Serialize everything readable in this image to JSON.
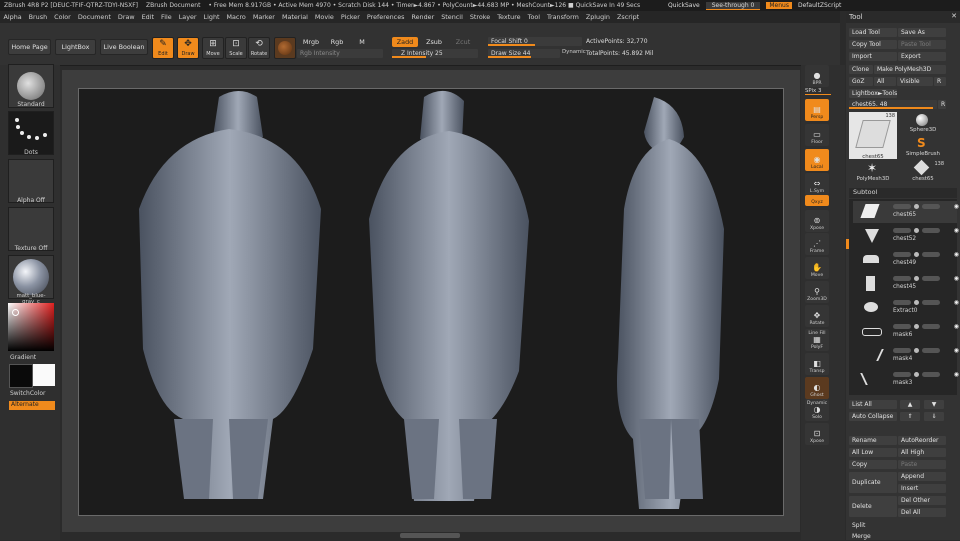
{
  "titlebar": {
    "app": "ZBrush 4R8 P2 [DEUC-TFIF-QTRZ-TDYI-NSXF]",
    "document": "ZBrush Document",
    "status": "• Free Mem 8.917GB • Active Mem 4970 • Scratch Disk 144 • Timer►4.867 • PolyCount►44.683 MP • MeshCount►126 ■ QuickSave In 49 Secs",
    "quicksave": "QuickSave",
    "seethrough": "See-through  0",
    "menus": "Menus",
    "script": "DefaultZScript"
  },
  "menu": [
    "Alpha",
    "Brush",
    "Color",
    "Document",
    "Draw",
    "Edit",
    "File",
    "Layer",
    "Light",
    "Macro",
    "Marker",
    "Material",
    "Movie",
    "Picker",
    "Preferences",
    "Render",
    "Stencil",
    "Stroke",
    "Texture",
    "Tool",
    "Transform",
    "Zplugin",
    "Zscript"
  ],
  "toolbar": {
    "home": "Home Page",
    "lightbox": "LightBox",
    "liveboolean": "Live Boolean",
    "edit": "Edit",
    "draw": "Draw",
    "move": "Move",
    "scale": "Scale",
    "rotate": "Rotate",
    "mrgb": "Mrgb",
    "rgb": "Rgb",
    "m": "M",
    "rgb_intensity": "Rgb Intensity",
    "zadd": "Zadd",
    "zsub": "Zsub",
    "zcut": "Zcut",
    "z_intensity": "Z Intensity 25",
    "focal": "Focal Shift 0",
    "drawsize": "Draw Size 44",
    "dynamic": "Dynamic",
    "active_points": "ActivePoints: 32,770",
    "total_points": "TotalPoints: 45.892 Mil"
  },
  "left": {
    "brush": "Standard",
    "stroke": "Dots",
    "alpha": "Alpha Off",
    "texture": "Texture Off",
    "material": "matt_blue-gray_c",
    "gradient": "Gradient",
    "switch": "SwitchColor",
    "alternate": "Alternate"
  },
  "right": {
    "bpr": "BPR",
    "spix": "SPix 3",
    "persp": "Persp",
    "floor": "Floor",
    "local": "Local",
    "lsym": "L.Sym",
    "xyz": "Qxyz",
    "frame": "Frame",
    "move": "Move",
    "zoom3d": "Zoom3D",
    "rotate": "Rotate",
    "linefill": "Line Fill",
    "polyf": "PolyF",
    "transp": "Transp",
    "ghost": "Ghost",
    "solo": "Solo",
    "xpose": "Xpose",
    "dynamic": "Dynamic"
  },
  "tool": {
    "title": "Tool",
    "load": "Load Tool",
    "saveas": "Save As",
    "copy": "Copy Tool",
    "paste": "Paste Tool",
    "import": "Import",
    "export": "Export",
    "clone": "Clone",
    "makepoly": "Make PolyMesh3D",
    "goz": "GoZ",
    "all": "All",
    "visible": "Visible",
    "r": "R",
    "lightbox_tools": "Lightbox►Tools",
    "current": "chest65. 48",
    "thumbs": [
      {
        "name": "chest65",
        "count": "138"
      },
      {
        "name": "Sphere3D",
        "count": ""
      },
      {
        "name": "SimpleBrush",
        "count": ""
      },
      {
        "name": "PolyMesh3D",
        "count": ""
      },
      {
        "name": "chest65",
        "count": "138"
      }
    ],
    "subtool_title": "Subtool",
    "subtools": [
      "chest65",
      "chest52",
      "chest49",
      "chest45",
      "Extract0",
      "mask6",
      "mask4",
      "mask3"
    ],
    "listall": "List All",
    "autocollapse": "Auto Collapse",
    "rename": "Rename",
    "autoreorder": "AutoReorder",
    "alllow": "All Low",
    "allhigh": "All High",
    "copy2": "Copy",
    "paste2": "Paste",
    "duplicate": "Duplicate",
    "append": "Append",
    "insert": "Insert",
    "delete": "Delete",
    "delother": "Del Other",
    "delall": "Del All",
    "split": "Split",
    "merge": "Merge"
  },
  "colors": {
    "accent": "#f08a1c",
    "bg": "#2b2b2b",
    "canvas": "#1c1c1c"
  }
}
